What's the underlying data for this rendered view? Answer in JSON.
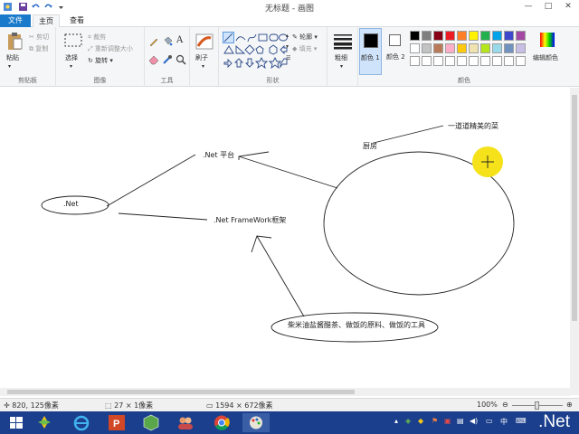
{
  "window": {
    "title": "无标题 - 画图"
  },
  "tabs": {
    "file": "文件",
    "home": "主页",
    "view": "查看"
  },
  "clipboard": {
    "paste": "粘贴",
    "cut": "剪切",
    "copy": "复制",
    "label": "剪贴板"
  },
  "image": {
    "select": "选择",
    "crop": "裁剪",
    "resize": "重新调整大小",
    "rotate": "旋转",
    "label": "图像"
  },
  "tools": {
    "label": "工具"
  },
  "brushes": {
    "label": "刷子"
  },
  "shapes": {
    "outline": "轮廓",
    "fill": "填充",
    "label": "形状"
  },
  "size": {
    "label": "粗细"
  },
  "colors": {
    "color1": "颜色 1",
    "color2": "颜色 2",
    "edit": "编辑颜色",
    "label": "颜色",
    "palette": [
      "#000000",
      "#7f7f7f",
      "#880015",
      "#ed1c24",
      "#ff7f27",
      "#fff200",
      "#22b14c",
      "#00a2e8",
      "#3f48cc",
      "#a349a4",
      "#ffffff",
      "#c3c3c3",
      "#b97a57",
      "#ffaec9",
      "#ffc90e",
      "#efe4b0",
      "#b5e61d",
      "#99d9ea",
      "#7092be",
      "#c8bfe7"
    ],
    "color1_value": "#000000",
    "color2_value": "#ffffff"
  },
  "canvas": {
    "texts": {
      "net": ".Net",
      "platform": ".Net 平台",
      "framework": ".Net FrameWork框架",
      "kitchen": "厨房",
      "dish": "一道道精美的菜",
      "ingredients": "柴米油盐酱醋茶、做饭的原料、做饭的工具"
    }
  },
  "status": {
    "cursor": "820, 125像素",
    "selection": "27 × 1像素",
    "canvas_size": "1594 × 672像素",
    "zoom": "100%"
  },
  "taskbar": {
    "clock": "中",
    "logo": ".Net"
  }
}
